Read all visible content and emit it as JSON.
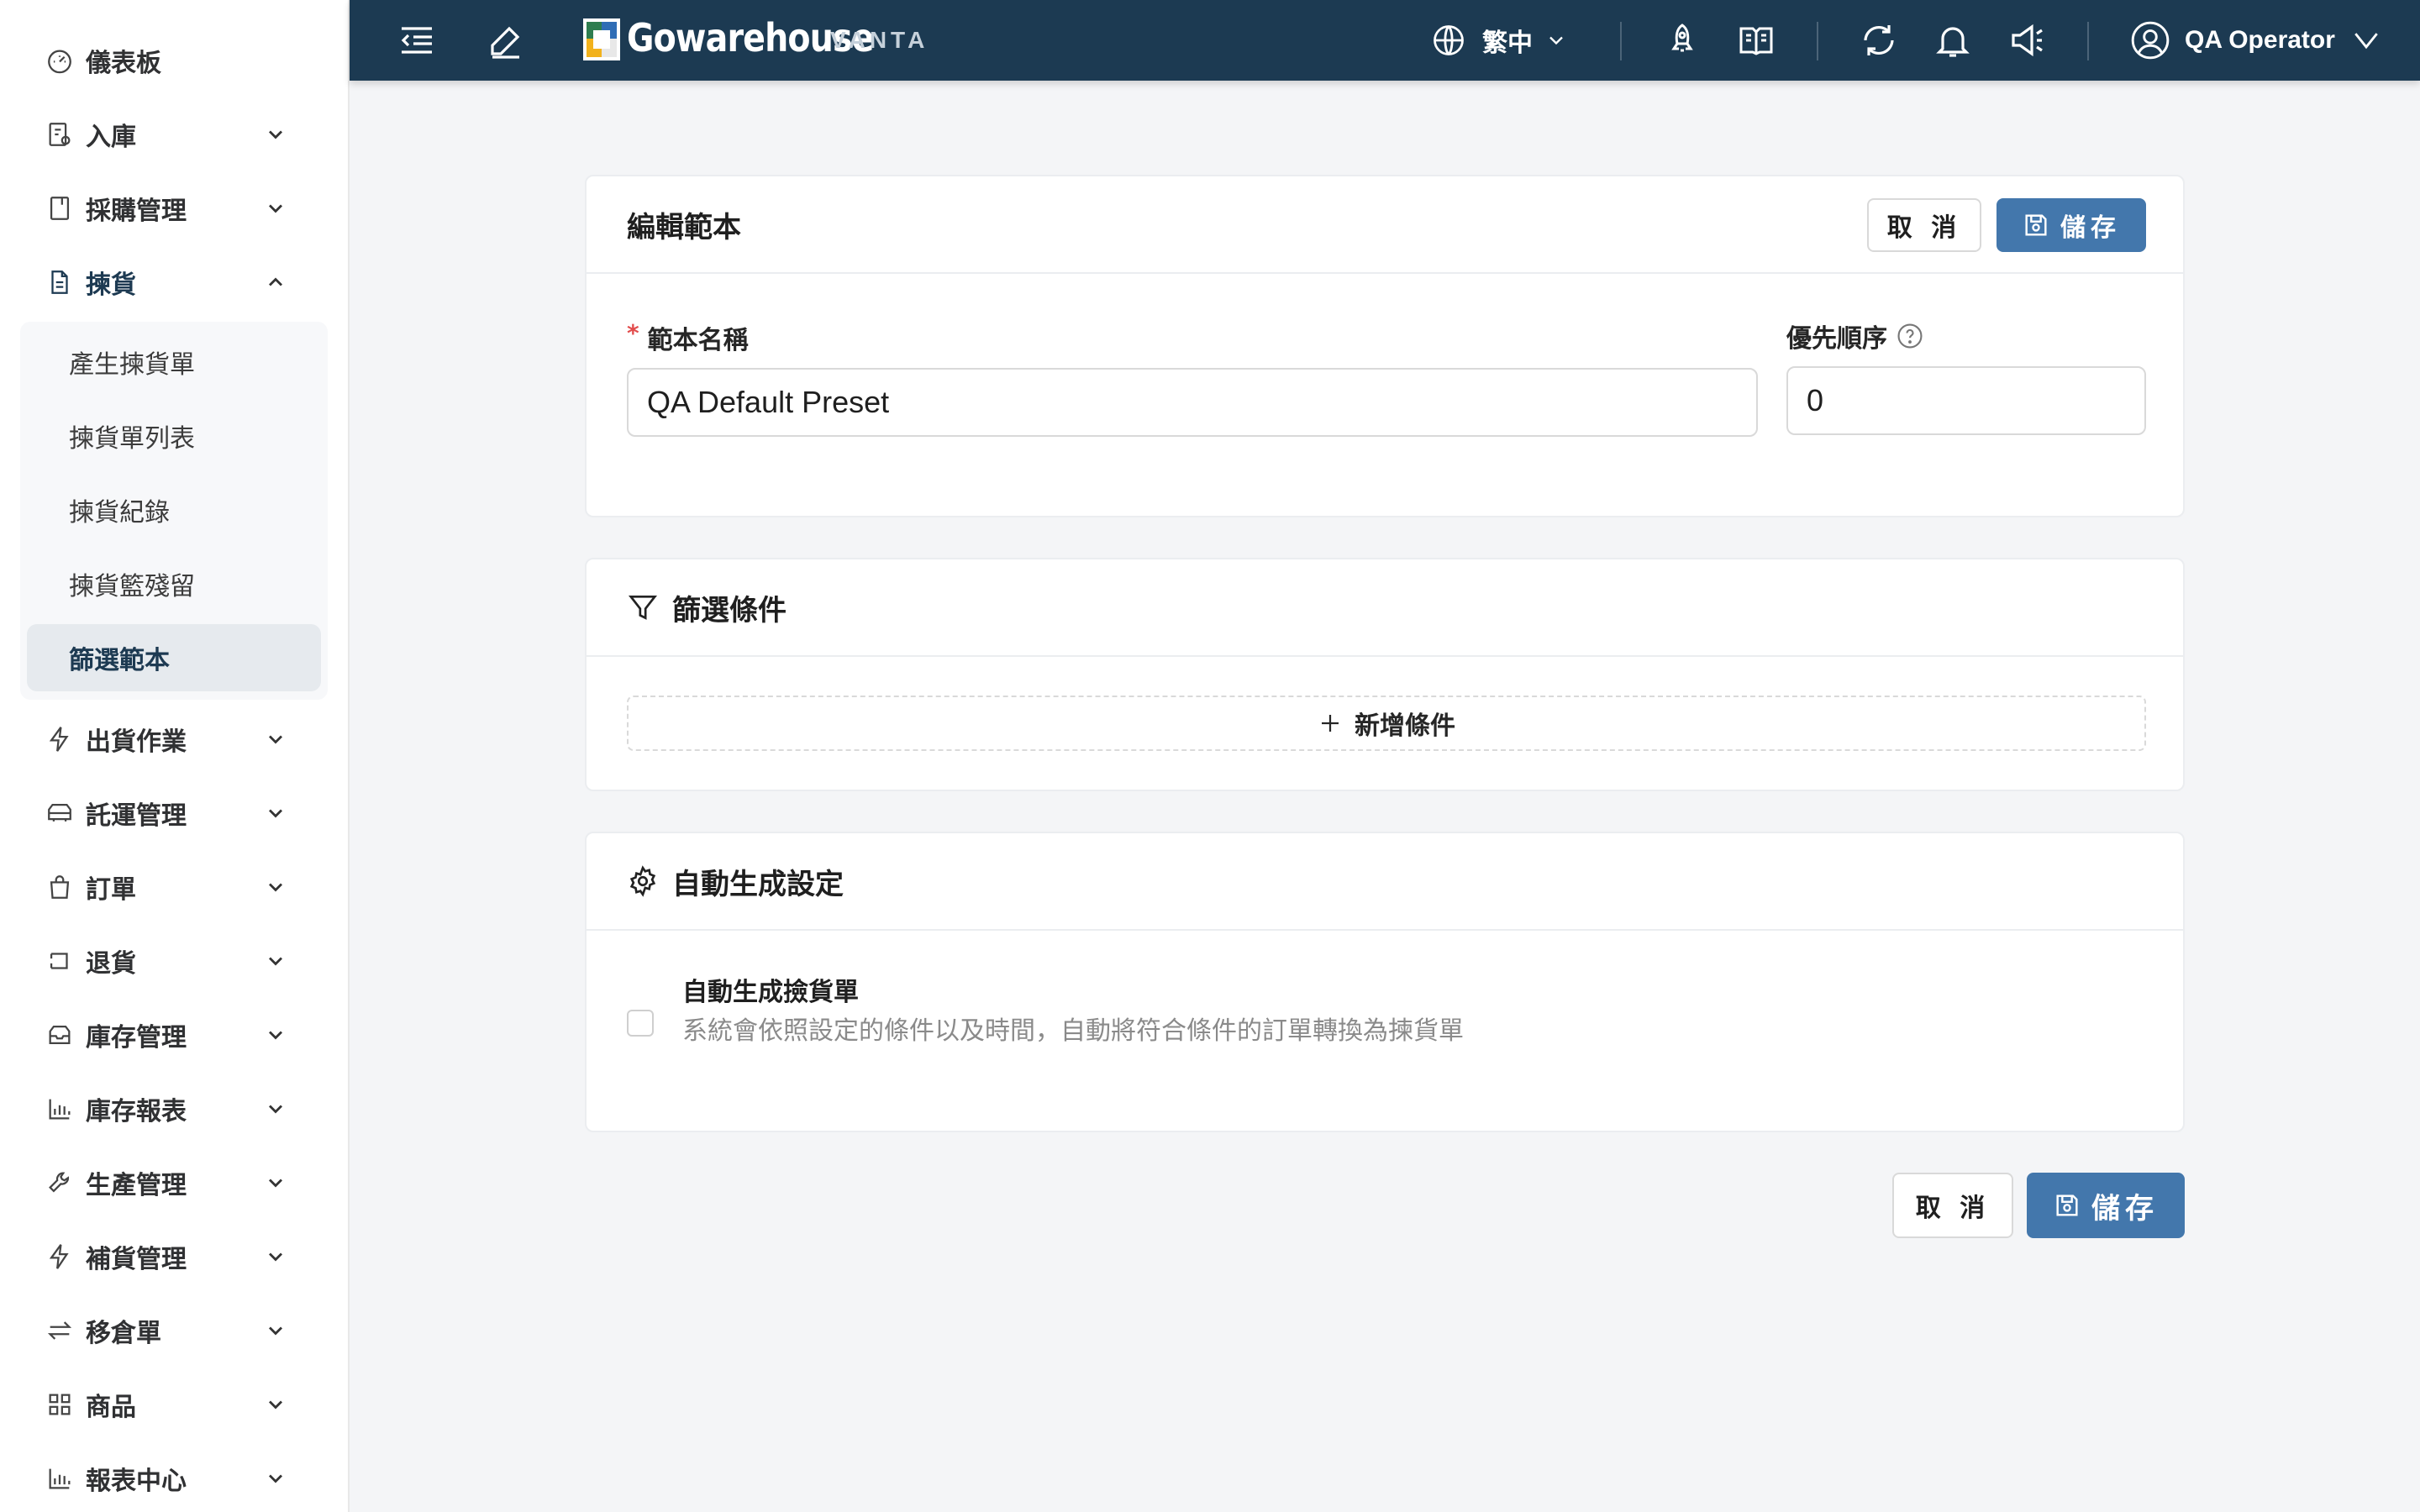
{
  "sidebar": {
    "items": [
      {
        "label": "儀表板",
        "icon": "dashboard-icon"
      },
      {
        "label": "入庫",
        "icon": "receiving-icon"
      },
      {
        "label": "採購管理",
        "icon": "purchase-icon"
      },
      {
        "label": "揀貨",
        "icon": "picking-icon"
      },
      {
        "label": "出貨作業",
        "icon": "shipping-icon"
      },
      {
        "label": "託運管理",
        "icon": "truck-icon"
      },
      {
        "label": "訂單",
        "icon": "shopping-bag-icon"
      },
      {
        "label": "退貨",
        "icon": "return-icon"
      },
      {
        "label": "庫存管理",
        "icon": "inventory-icon"
      },
      {
        "label": "庫存報表",
        "icon": "bar-chart-icon"
      },
      {
        "label": "生產管理",
        "icon": "wrench-icon"
      },
      {
        "label": "補貨管理",
        "icon": "lightning-icon"
      },
      {
        "label": "移倉單",
        "icon": "transfer-icon"
      },
      {
        "label": "商品",
        "icon": "grid-icon"
      },
      {
        "label": "報表中心",
        "icon": "report-chart-icon"
      }
    ],
    "picking_submenu": [
      {
        "label": "產生揀貨單"
      },
      {
        "label": "揀貨單列表"
      },
      {
        "label": "揀貨紀錄"
      },
      {
        "label": "揀貨籃殘留"
      },
      {
        "label": "篩選範本"
      }
    ]
  },
  "header": {
    "logo_text": "Gowarehouse",
    "logo_sub": "VANTA",
    "language": "繁中",
    "user_name": "QA Operator"
  },
  "edit_card": {
    "title": "編輯範本",
    "cancel_label": "取 消",
    "save_label": "儲存",
    "name_label": "範本名稱",
    "name_value": "QA Default Preset",
    "priority_label": "優先順序",
    "priority_value": "0"
  },
  "filter_card": {
    "title": "篩選條件",
    "add_condition_label": "新增條件"
  },
  "auto_card": {
    "title": "自動生成設定",
    "option_title": "自動生成撿貨單",
    "option_desc": "系統會依照設定的條件以及時間，自動將符合條件的訂單轉換為揀貨單"
  },
  "footer": {
    "cancel_label": "取 消",
    "save_label": "儲存"
  },
  "colors": {
    "header_bg": "#1c3a52",
    "primary": "#4377ac",
    "required": "#e24c4c"
  }
}
